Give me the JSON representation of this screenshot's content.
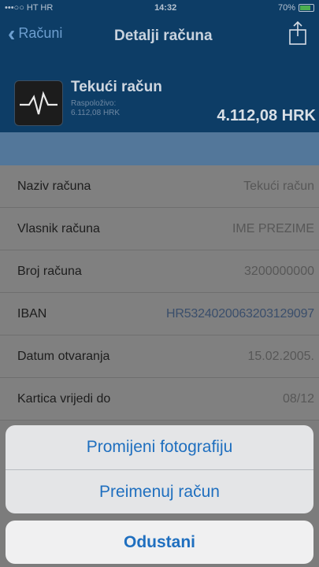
{
  "status_bar": {
    "carrier": "•••○○ HT HR",
    "time": "14:32",
    "battery": "70%"
  },
  "nav": {
    "back_label": "Računi",
    "title": "Detalji računa"
  },
  "account": {
    "name": "Tekući račun",
    "available_label": "Raspoloživo:",
    "available_value": "6.112,08 HRK",
    "balance": "4.112,08 HRK"
  },
  "details": [
    {
      "label": "Naziv računa",
      "value": "Tekući račun"
    },
    {
      "label": "Vlasnik računa",
      "value": "IME PREZIME"
    },
    {
      "label": "Broj računa",
      "value": "3200000000"
    },
    {
      "label": "IBAN",
      "value": "HR5324020063203129097"
    },
    {
      "label": "Datum otvaranja",
      "value": "15.02.2005."
    },
    {
      "label": "Kartica vrijedi do",
      "value": "08/12"
    }
  ],
  "action_sheet": {
    "options": [
      "Promijeni fotografiju",
      "Preimenuj račun"
    ],
    "cancel": "Odustani"
  },
  "colors": {
    "nav_bg": "#0d3d66",
    "accent": "#1f6fbf",
    "overlay": "#808080"
  }
}
